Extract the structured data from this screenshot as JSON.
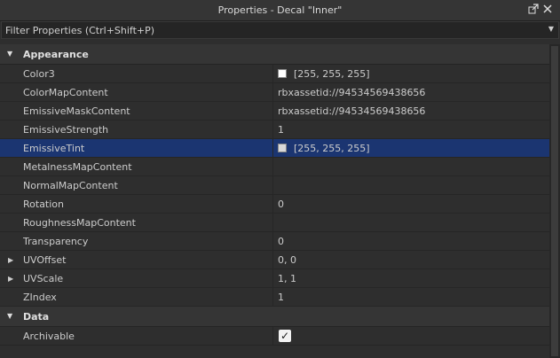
{
  "window": {
    "title": "Properties - Decal \"Inner\"",
    "undock_icon": "undock-icon",
    "close_icon": "close-icon"
  },
  "filter": {
    "placeholder": "Filter Properties (Ctrl+Shift+P)",
    "value": ""
  },
  "categories": {
    "appearance": {
      "label": "Appearance",
      "rows": [
        {
          "name": "Color3",
          "value": "[255, 255, 255]",
          "swatch": "#ffffff"
        },
        {
          "name": "ColorMapContent",
          "value": "rbxassetid://94534569438656"
        },
        {
          "name": "EmissiveMaskContent",
          "value": "rbxassetid://94534569438656"
        },
        {
          "name": "EmissiveStrength",
          "value": "1"
        },
        {
          "name": "EmissiveTint",
          "value": "[255, 255, 255]",
          "swatch": "#d9d9d9",
          "selected": true
        },
        {
          "name": "MetalnessMapContent",
          "value": ""
        },
        {
          "name": "NormalMapContent",
          "value": ""
        },
        {
          "name": "Rotation",
          "value": "0"
        },
        {
          "name": "RoughnessMapContent",
          "value": ""
        },
        {
          "name": "Transparency",
          "value": "0"
        },
        {
          "name": "UVOffset",
          "value": "0, 0",
          "expandable": true
        },
        {
          "name": "UVScale",
          "value": "1, 1",
          "expandable": true
        },
        {
          "name": "ZIndex",
          "value": "1"
        }
      ]
    },
    "data": {
      "label": "Data",
      "rows": [
        {
          "name": "Archivable",
          "checked": true
        }
      ]
    }
  },
  "colors": {
    "selection": "#1b3571",
    "background": "#2e2e2e",
    "header": "#353535"
  }
}
